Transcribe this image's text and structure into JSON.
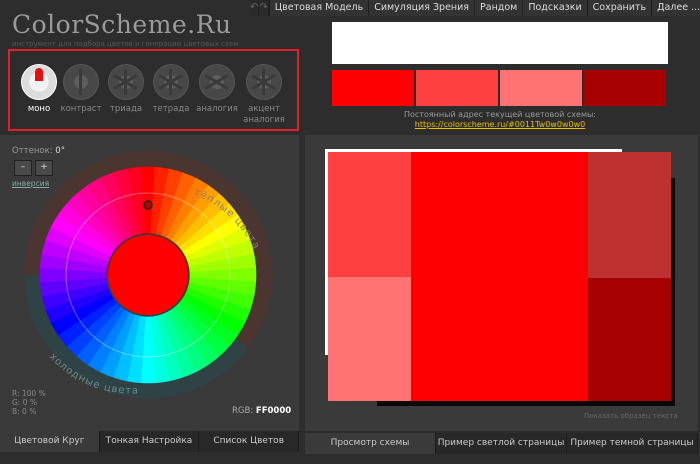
{
  "menu": {
    "undo_icon": "undo-arrow-icon",
    "redo_icon": "redo-arrow-icon",
    "items": [
      "Цветовая Модель",
      "Симуляция Зрения",
      "Рандом",
      "Подсказки",
      "Сохранить",
      "Далее ..."
    ]
  },
  "logo": "ColorScheme.Ru",
  "tagline": "инструмент для подбора цветов и генерации цветовых схем",
  "modes": [
    {
      "label": "моно",
      "active": true
    },
    {
      "label": "контраст",
      "active": false
    },
    {
      "label": "триада",
      "active": false
    },
    {
      "label": "тетрада",
      "active": false
    },
    {
      "label": "аналогия",
      "active": false
    },
    {
      "label": "акцент аналогия",
      "active": false
    }
  ],
  "hue": {
    "label": "Оттенок:",
    "value": "0°"
  },
  "controls": {
    "minus": "–",
    "plus": "+",
    "inversion": "инверсия"
  },
  "wheel": {
    "warm_label": "тёплые цвета",
    "cold_label": "холодные цвета",
    "center_color": "#ff0000"
  },
  "rgb": {
    "r": "R: 100 %",
    "g": "G:    0 %",
    "b": "B:    0 %",
    "label": "RGB:",
    "hex": "FF0000"
  },
  "left_tabs": [
    "Цветовой Круг",
    "Тонкая Настройка",
    "Список Цветов"
  ],
  "swatches": [
    "#ff0000",
    "#ff4040",
    "#ff7373",
    "#a60000"
  ],
  "permalink": {
    "text": "Постоянный адрес текущей цветовой схемы:",
    "url": "https://colorscheme.ru/#0011Tw0w0w0w0"
  },
  "scheme_colors": {
    "primary": "#ff0000",
    "light1": "#ff4040",
    "light2": "#ff7373",
    "dark1": "#bf3030",
    "dark2": "#a60000"
  },
  "sample_text": "Показать образец текста",
  "right_tabs": [
    "Просмотр схемы",
    "Пример светлой страницы",
    "Пример темной страницы"
  ]
}
